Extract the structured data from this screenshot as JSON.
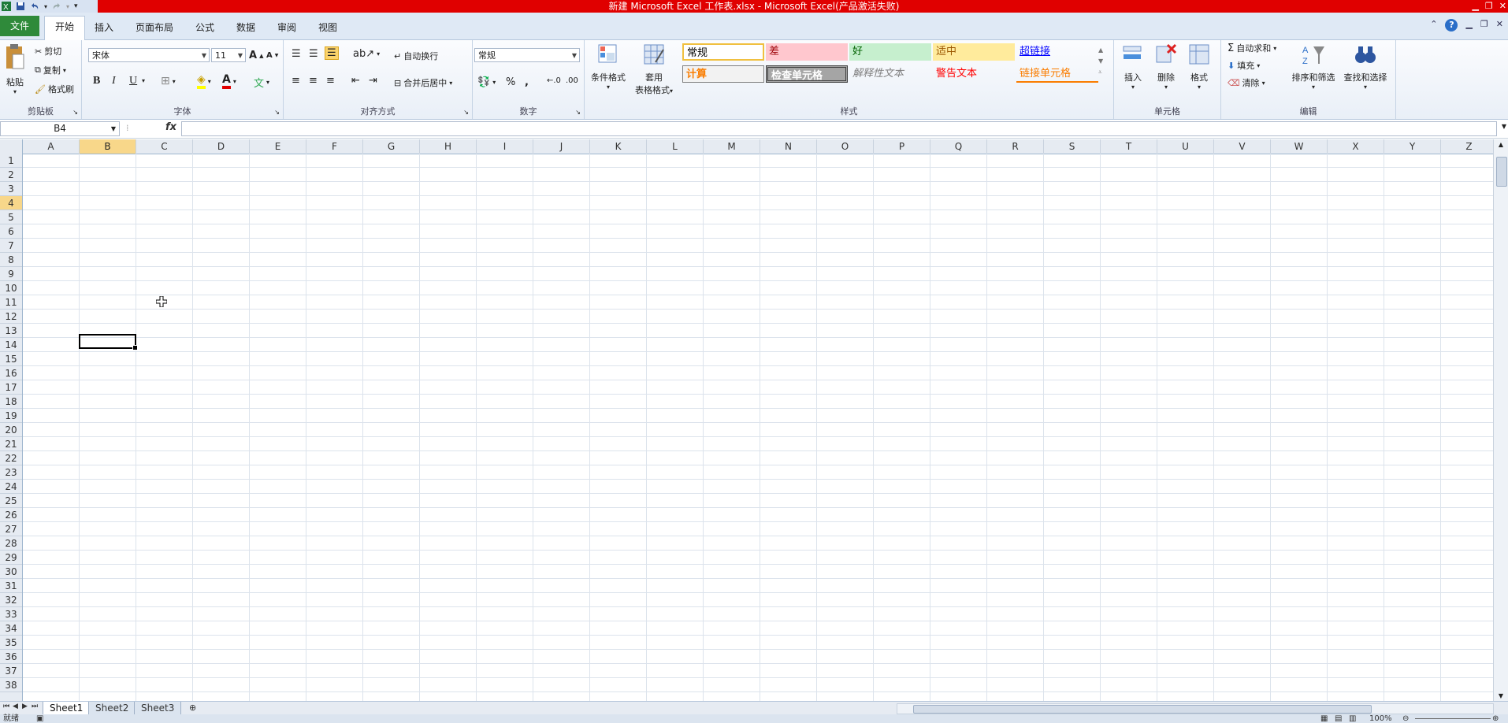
{
  "window": {
    "title": "新建 Microsoft Excel 工作表.xlsx - Microsoft Excel(产品激活失败)"
  },
  "tabs": {
    "file": "文件",
    "items": [
      "开始",
      "插入",
      "页面布局",
      "公式",
      "数据",
      "审阅",
      "视图"
    ],
    "active": "开始"
  },
  "ribbon": {
    "clipboard": {
      "label": "剪贴板",
      "paste": "粘贴",
      "cut": "剪切",
      "copy": "复制",
      "format_painter": "格式刷"
    },
    "font": {
      "label": "字体",
      "font_name": "宋体",
      "font_size": "11"
    },
    "alignment": {
      "label": "对齐方式",
      "wrap": "自动换行",
      "merge": "合并后居中"
    },
    "number": {
      "label": "数字",
      "format": "常规"
    },
    "styles": {
      "label": "样式",
      "conditional_format": "条件格式",
      "table_format_line1": "套用",
      "table_format_line2": "表格格式",
      "cells": [
        {
          "text": "常规",
          "bg": "#ffffff",
          "fg": "#000000"
        },
        {
          "text": "差",
          "bg": "#ffc7ce",
          "fg": "#9c0006"
        },
        {
          "text": "好",
          "bg": "#c6efce",
          "fg": "#006100"
        },
        {
          "text": "适中",
          "bg": "#ffeb9c",
          "fg": "#9c5700"
        },
        {
          "text": "超链接",
          "bg": "transparent",
          "fg": "#0000ff"
        },
        {
          "text": "计算",
          "bg": "#f2f2f2",
          "fg": "#fa7d00"
        },
        {
          "text": "检查单元格",
          "bg": "#a5a5a5",
          "fg": "#ffffff"
        },
        {
          "text": "解释性文本",
          "bg": "transparent",
          "fg": "#7f7f7f"
        },
        {
          "text": "警告文本",
          "bg": "transparent",
          "fg": "#ff0000"
        },
        {
          "text": "链接单元格",
          "bg": "transparent",
          "fg": "#fa7d00"
        }
      ]
    },
    "cells_group": {
      "label": "单元格",
      "insert": "插入",
      "delete": "删除",
      "format": "格式"
    },
    "editing": {
      "label": "编辑",
      "autosum": "自动求和",
      "fill": "填充",
      "clear": "清除",
      "sort": "排序和筛选",
      "find": "查找和选择"
    }
  },
  "formula_bar": {
    "name_box": "B4",
    "fx": "fx",
    "content": ""
  },
  "grid": {
    "columns": [
      "A",
      "B",
      "C",
      "D",
      "E",
      "F",
      "G",
      "H",
      "I",
      "J",
      "K",
      "L",
      "M",
      "N",
      "O",
      "P",
      "Q",
      "R",
      "S",
      "T",
      "U",
      "V",
      "W",
      "X",
      "Y",
      "Z"
    ],
    "rows": [
      "1",
      "2",
      "3",
      "4",
      "5",
      "6",
      "7",
      "8",
      "9",
      "10",
      "11",
      "12",
      "13",
      "14",
      "15",
      "16",
      "17",
      "18",
      "19",
      "20",
      "21",
      "22",
      "23",
      "24",
      "25",
      "26",
      "27",
      "28",
      "29",
      "30",
      "31",
      "32",
      "33",
      "34",
      "35",
      "36",
      "37",
      "38"
    ],
    "selected_column": "B",
    "selected_row": "4"
  },
  "sheets": {
    "items": [
      "Sheet1",
      "Sheet2",
      "Sheet3"
    ],
    "active": "Sheet1"
  },
  "status": {
    "ready": "就绪",
    "zoom": "100%"
  },
  "colors": {
    "title_bar": "#e00000",
    "file_tab": "#2f8a3a",
    "selection_header": "#f8d78a"
  }
}
